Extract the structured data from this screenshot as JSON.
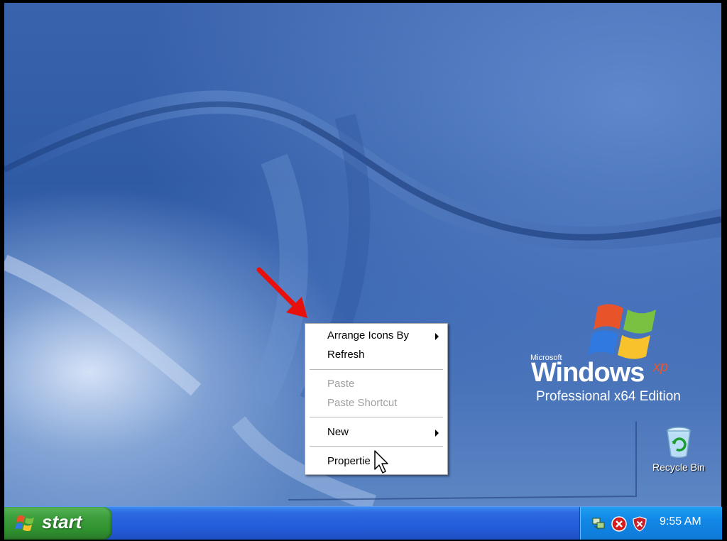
{
  "desktop": {
    "logo": {
      "microsoft": "Microsoft",
      "windows": "Windows",
      "xp": "xp",
      "edition": "Professional x64 Edition"
    },
    "icons": [
      {
        "label": "Recycle Bin",
        "icon": "recycle-bin-icon"
      }
    ]
  },
  "context_menu": {
    "items": [
      {
        "label": "Arrange Icons By",
        "submenu": true,
        "enabled": true
      },
      {
        "label": "Refresh",
        "submenu": false,
        "enabled": true
      },
      {
        "label": "Paste",
        "submenu": false,
        "enabled": false
      },
      {
        "label": "Paste Shortcut",
        "submenu": false,
        "enabled": false
      },
      {
        "label": "New",
        "submenu": true,
        "enabled": true
      },
      {
        "label": "Propertie",
        "submenu": false,
        "enabled": true
      }
    ]
  },
  "taskbar": {
    "start_label": "start",
    "tray_icons": [
      "network-icon",
      "security-alert-icon",
      "security-center-shield-icon"
    ],
    "clock": "9:55 AM"
  },
  "colors": {
    "annotation_arrow": "#e8100c",
    "taskbar_blue": "#245edb",
    "start_green": "#3d9f3d",
    "tray_blue": "#1187e6"
  }
}
